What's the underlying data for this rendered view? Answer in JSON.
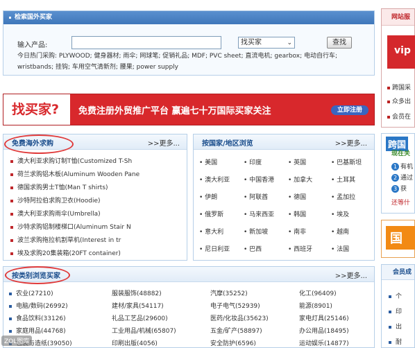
{
  "search": {
    "title": "检索国外买家",
    "label": "输入产品:",
    "input_value": "",
    "select_value": "找买家",
    "button": "查找",
    "hot": "今日热门采购: PLYWOOD; 健身器材; 雨伞; 网球笔; 促销礼品; MDF; PVC sheet; 直流电机; gearbox; 电动自行车; wristbands; 挂钩; 车用空气清新剂; 腰果; power supply"
  },
  "banner": {
    "left": "找买家?",
    "slogan": "免费注册外贸推广平台  赢遍七十万国际买家关注",
    "register": "立即注册"
  },
  "demand": {
    "title": "免费海外求购",
    "more": ">>更多...",
    "items": [
      "澳大利亚求购订制T恤(Customized T-Sh",
      "荷兰求购铝木板(Aluminum Wooden Pane",
      "德国求购男士T恤(Man T shirts)",
      "沙特阿拉伯求购卫衣(Hoodie)",
      "澳大利亚求购雨伞(Umbrella)",
      "沙特求购铝制楼梯口(Aluminum Stair N",
      "波兰求购拖拉机割草机(Interest in tr",
      "埃及求购20集装箱(20FT container)"
    ]
  },
  "country": {
    "title": "按国家/地区浏览",
    "more": ">>更多...",
    "rows": [
      [
        "• 美国",
        "• 印度",
        "• 英国",
        "• 巴基斯坦"
      ],
      [
        "• 澳大利亚",
        "• 中国香港",
        "• 加拿大",
        "• 土耳其"
      ],
      [
        "• 伊朗",
        "• 阿联酋",
        "• 德国",
        "• 孟加拉"
      ],
      [
        "• 俄罗斯",
        "• 马来西亚",
        "• 韩国",
        "• 埃及"
      ],
      [
        "• 意大利",
        "• 新加坡",
        "• 南非",
        "• 越南"
      ],
      [
        "• 尼日利亚",
        "• 巴西",
        "• 西班牙",
        "• 法国"
      ]
    ]
  },
  "category": {
    "title": "按类别浏览买家",
    "more": ">>更多...",
    "rows": [
      [
        "农业(27210)",
        "服装服饰(48882)",
        "汽摩(35252)",
        "化工(96409)"
      ],
      [
        "电脑/数码(26992)",
        "建材/家具(54117)",
        "电子电气(52939)",
        "能源(8901)"
      ],
      [
        "食品饮料(33126)",
        "礼品工艺品(29600)",
        "医药/化妆品(35623)",
        "家电灯具(25146)"
      ],
      [
        "家庭用品(44768)",
        "工业用品/机械(65807)",
        "五金/矿产(58897)",
        "办公用品(18495)"
      ],
      [
        "包装与造纸(39050)",
        "印刷出版(4056)",
        "安全防护(6596)",
        "运动娱乐(14877)"
      ]
    ]
  },
  "right_top": {
    "title": "网站服",
    "vip": "vip",
    "items": [
      "跨国采",
      "众多出",
      "会员在"
    ]
  },
  "right_mid": {
    "logo": "跨国",
    "now": "现在关",
    "steps": [
      "有机",
      "通过",
      "获"
    ],
    "more": "还等什"
  },
  "right_ad": {
    "text": "国"
  },
  "right_bottom": {
    "title": "会员成",
    "items": [
      "个",
      "印",
      "出",
      "耐"
    ]
  },
  "watermark": "ZOL图库"
}
